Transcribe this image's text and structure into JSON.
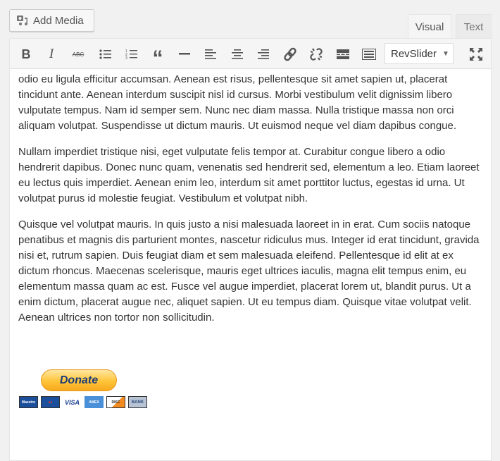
{
  "header": {
    "add_media": "Add Media",
    "tabs": [
      {
        "label": "Visual",
        "active": true
      },
      {
        "label": "Text",
        "active": false
      }
    ]
  },
  "toolbar": {
    "buttons": [
      "bold-icon",
      "italic-icon",
      "strikethrough-icon",
      "bullet-list-icon",
      "numbered-list-icon",
      "blockquote-icon",
      "horizontal-rule-icon",
      "align-left-icon",
      "align-center-icon",
      "align-right-icon",
      "link-icon",
      "unlink-icon",
      "read-more-icon",
      "toolbar-toggle-icon"
    ],
    "select": "RevSlider",
    "fullscreen": "fullscreen-icon"
  },
  "content": {
    "paragraphs": [
      "odio eu ligula efficitur accumsan. Aenean est risus, pellentesque sit amet sapien ut, placerat tincidunt ante. Aenean interdum suscipit nisl id cursus. Morbi vestibulum velit dignissim libero vulputate tempus. Nam id semper sem. Nunc nec diam massa. Nulla tristique massa non orci aliquam volutpat. Suspendisse ut dictum mauris. Ut euismod neque vel diam dapibus congue.",
      "Nullam imperdiet tristique nisi, eget vulputate felis tempor at. Curabitur congue libero a odio hendrerit dapibus. Donec nunc quam, venenatis sed hendrerit sed, elementum a leo. Etiam laoreet eu lectus quis imperdiet. Aenean enim leo, interdum sit amet porttitor luctus, egestas id urna. Ut volutpat purus id molestie feugiat. Vestibulum et volutpat nibh.",
      "Quisque vel volutpat mauris. In quis justo a nisi malesuada laoreet in in erat. Cum sociis natoque penatibus et magnis dis parturient montes, nascetur ridiculus mus. Integer id erat tincidunt, gravida nisi et, rutrum sapien. Duis feugiat diam et sem malesuada eleifend. Pellentesque id elit at ex dictum rhoncus. Maecenas scelerisque, mauris eget ultrices iaculis, magna elit tempus enim, eu elementum massa quam ac est. Fusce vel augue imperdiet, placerat lorem ut, blandit purus. Ut a enim dictum, placerat augue nec, aliquet sapien. Ut eu tempus diam. Quisque vitae volutpat velit. Aenean ultrices non tortor non sollicitudin."
    ],
    "donate": "Donate",
    "cards": [
      "Maestro",
      "MasterCard",
      "VISA",
      "AMEX",
      "DISCOVER",
      "BANK"
    ]
  }
}
